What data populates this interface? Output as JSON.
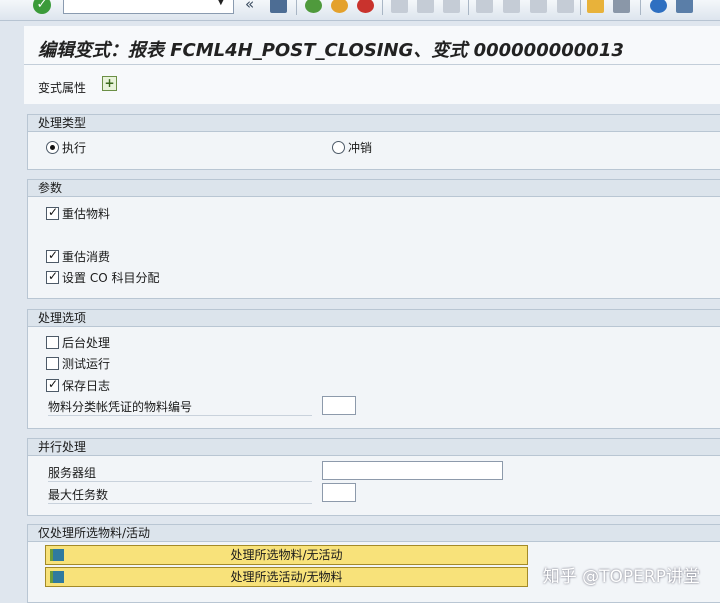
{
  "toolbar": {
    "command_field_value": "",
    "icons": [
      "ok-icon",
      "save-icon",
      "back-icon",
      "exit-icon",
      "cancel-icon",
      "print-icon",
      "find-icon",
      "find-next-icon",
      "first-page-icon",
      "previous-page-icon",
      "next-page-icon",
      "last-page-icon",
      "create-session-icon",
      "shortcut-icon",
      "help-icon",
      "layout-icon"
    ]
  },
  "header": {
    "title": "编辑变式：报表 FCML4H_POST_CLOSING、变式 000000000013"
  },
  "app_toolbar": {
    "variant_attributes_label": "变式属性"
  },
  "processing_type": {
    "title": "处理类型",
    "option_execute": "执行",
    "option_reverse": "冲销",
    "selected": "执行"
  },
  "parameters": {
    "title": "参数",
    "revalue_material": "重估物料",
    "revalue_consumption": "重估消费",
    "set_co_account_assignment": "设置 CO 科目分配"
  },
  "processing_options": {
    "title": "处理选项",
    "background_processing": "后台处理",
    "test_run": "测试运行",
    "save_log": "保存日志",
    "materials_per_document_label": "物料分类帐凭证的物料编号",
    "materials_per_document_value": ""
  },
  "parallel_processing": {
    "title": "并行处理",
    "server_group_label": "服务器组",
    "server_group_value": "",
    "max_tasks_label": "最大任务数",
    "max_tasks_value": ""
  },
  "selection": {
    "title": "仅处理所选物料/活动",
    "button_materials": "处理所选物料/无活动",
    "button_activities": "处理所选活动/无物料"
  },
  "watermark": "知乎 @TOPERP讲堂",
  "colors": {
    "background": "#dfe6ee",
    "group_header": "#dce4ec",
    "action_button": "#f8e27a"
  }
}
